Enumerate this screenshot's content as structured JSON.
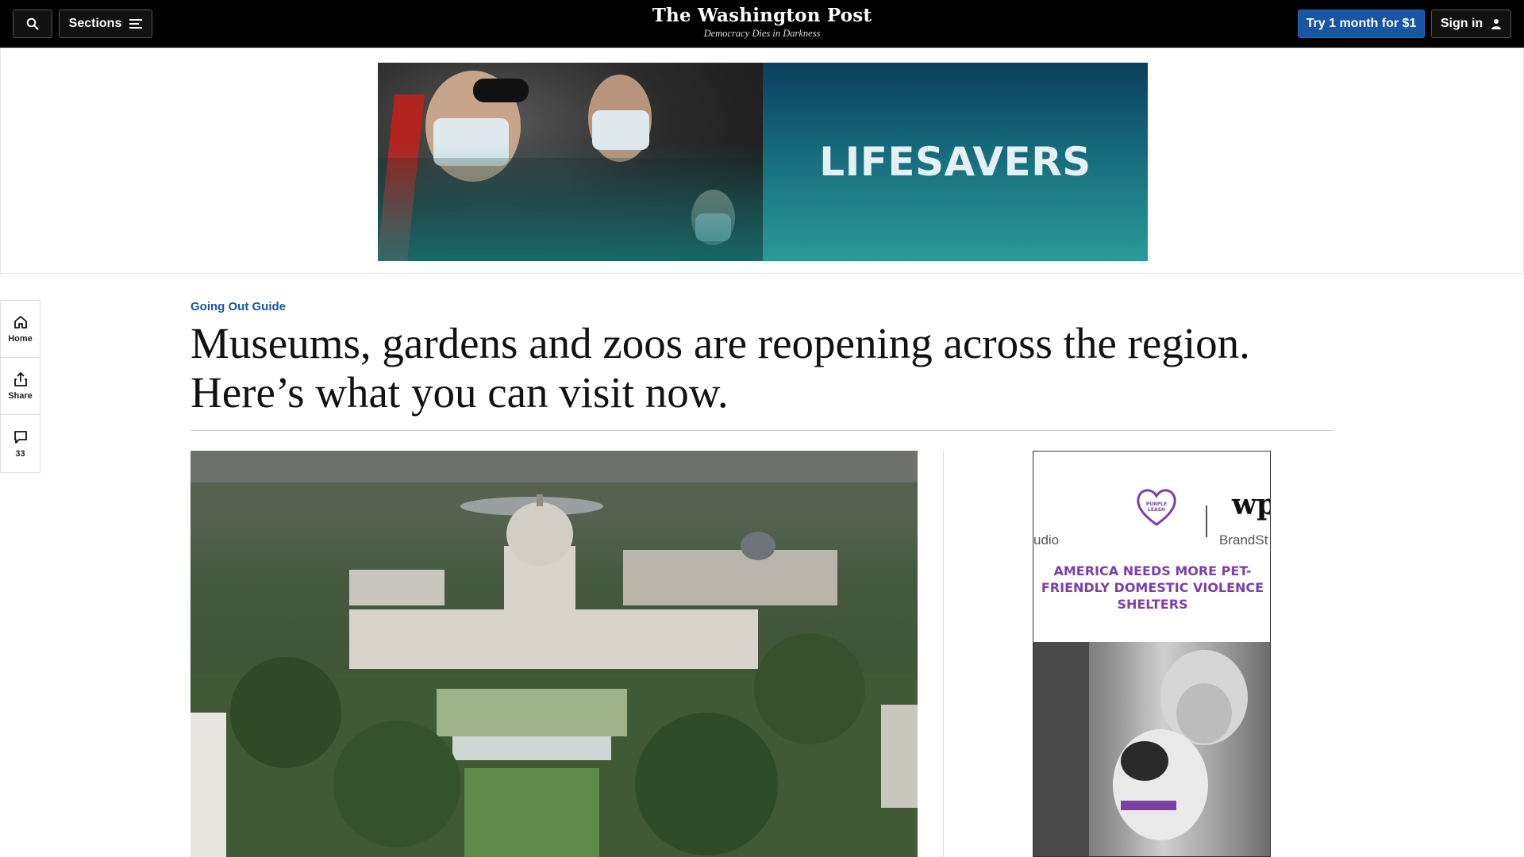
{
  "topbar": {
    "sections_label": "Sections",
    "logo": "The Washington Post",
    "tagline": "Democracy Dies in Darkness",
    "subscribe_label": "Try 1 month for $1",
    "signin_label": "Sign in"
  },
  "banner_ad": {
    "brand_text": "LIFESAVERS"
  },
  "rail": {
    "home_label": "Home",
    "share_label": "Share",
    "comments_count": "33"
  },
  "article": {
    "kicker": "Going Out Guide",
    "headline": "Museums, gardens and zoos are reopening across the region. Here’s what you can visit now."
  },
  "side_ad": {
    "left_studio": "udio",
    "right_studio": "BrandSt",
    "wp_mark": "wp",
    "heart_text": "PURPLE LEASH",
    "headline": "AMERICA NEEDS MORE PET-FRIENDLY DOMESTIC VIOLENCE SHELTERS"
  },
  "colors": {
    "accent": "#1955a5",
    "topbar_bg": "#000000",
    "ad_purple": "#7b3fa6"
  }
}
